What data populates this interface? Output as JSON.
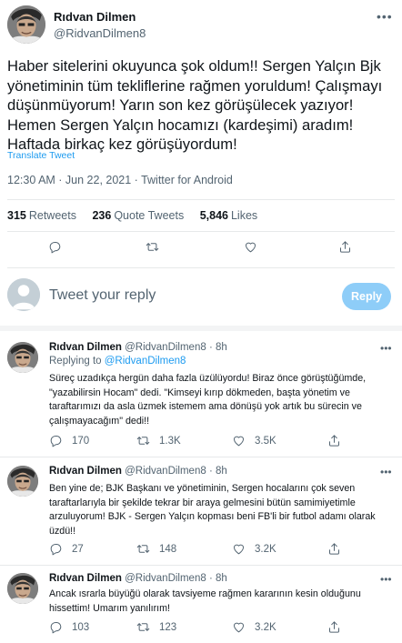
{
  "main_tweet": {
    "name": "Rıdvan Dilmen",
    "handle": "@RidvanDilmen8",
    "more_icon": "ellipsis-icon",
    "text": "Haber sitelerini okuyunca şok oldum!! Sergen Yalçın Bjk yönetiminin tüm tekliflerine rağmen yoruldum! Çalışmayı düşünmüyorum! Yarın son kez görüşülecek yazıyor! Hemen Sergen Yalçın hocamızı (kardeşimi) aradım! Haftada birkaç kez görüşüyordum!",
    "translate_label": "Translate Tweet",
    "meta": "12:30 AM · Jun 22, 2021 · Twitter for Android",
    "stats": {
      "retweets_count": "315",
      "retweets_label": "Retweets",
      "quotes_count": "236",
      "quotes_label": "Quote Tweets",
      "likes_count": "5,846",
      "likes_label": "Likes"
    }
  },
  "reply_box": {
    "placeholder": "Tweet your reply",
    "button_label": "Reply"
  },
  "replies": [
    {
      "name": "Rıdvan Dilmen",
      "handle": "@RidvanDilmen8",
      "time": "· 8h",
      "replying_prefix": "Replying to",
      "replying_handle": "@RidvanDilmen8",
      "text": "Süreç uzadıkça hergün daha fazla üzülüyordu! Biraz önce görüştüğümde, \"yazabilirsin Hocam\" dedi. \"Kimseyi kırıp dökmeden, başta yönetim ve taraftarımızı da asla üzmek istemem ama dönüşü yok artık bu sürecin ve çalışmayacağım\" dedi!!",
      "replies": "170",
      "retweets": "1.3K",
      "likes": "3.5K"
    },
    {
      "name": "Rıdvan Dilmen",
      "handle": "@RidvanDilmen8",
      "time": "· 8h",
      "text": "Ben yine de; BJK Başkanı ve yönetiminin, Sergen hocalarını çok seven taraftarlarıyla bir şekilde tekrar bir araya gelmesini bütün samimiyetimle arzuluyorum! BJK - Sergen Yalçın kopması beni FB'li bir futbol adamı olarak üzdü!!",
      "replies": "27",
      "retweets": "148",
      "likes": "3.2K"
    },
    {
      "name": "Rıdvan Dilmen",
      "handle": "@RidvanDilmen8",
      "time": "· 8h",
      "text": "Ancak ısrarla büyüğü olarak tavsiyeme rağmen kararının kesin olduğunu hissettim! Umarım yanılırım!",
      "replies": "103",
      "retweets": "123",
      "likes": "3.2K"
    }
  ],
  "icons": {
    "reply": "reply-icon",
    "retweet": "retweet-icon",
    "like": "heart-icon",
    "share": "share-icon"
  },
  "colors": {
    "accent": "#1d9bf0",
    "reply_button_disabled": "#8ecdf8",
    "secondary_text": "#536471",
    "divider": "#e7e9ea"
  }
}
